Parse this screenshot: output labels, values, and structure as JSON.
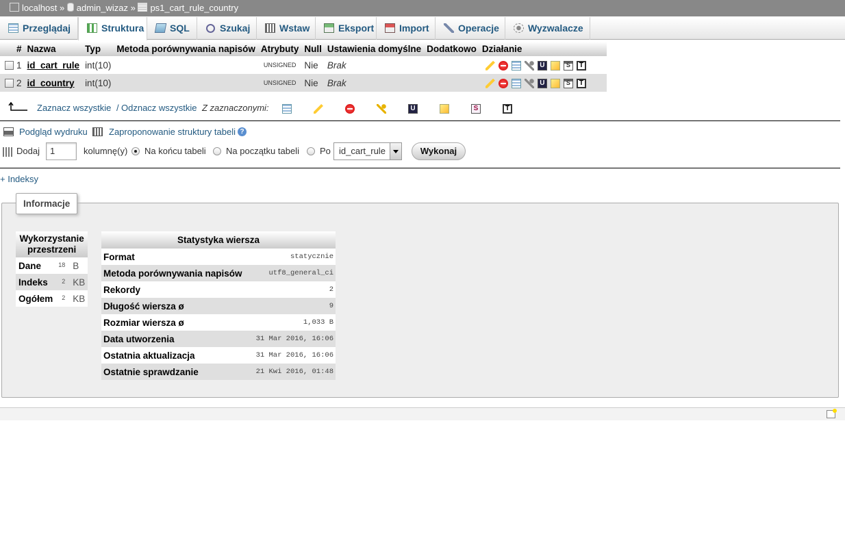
{
  "breadcrumb": {
    "server": "localhost",
    "database": "admin_wizaz",
    "table": "ps1_cart_rule_country",
    "separator": "»"
  },
  "tabs": [
    {
      "label": "Przeglądaj",
      "icon": "browse-icon"
    },
    {
      "label": "Struktura",
      "icon": "structure-icon",
      "active": true
    },
    {
      "label": "SQL",
      "icon": "sql-icon"
    },
    {
      "label": "Szukaj",
      "icon": "search-icon"
    },
    {
      "label": "Wstaw",
      "icon": "insert-icon"
    },
    {
      "label": "Eksport",
      "icon": "export-icon"
    },
    {
      "label": "Import",
      "icon": "import-icon"
    },
    {
      "label": "Operacje",
      "icon": "wrench-icon"
    },
    {
      "label": "Wyzwalacze",
      "icon": "triggers-icon"
    }
  ],
  "structure": {
    "headers": [
      "#",
      "Nazwa",
      "Typ",
      "Metoda porównywania napisów",
      "Atrybuty",
      "Null",
      "Ustawienia domyślne",
      "Dodatkowo",
      "Działanie"
    ],
    "rows": [
      {
        "num": "1",
        "name": "id_cart_rule",
        "type": "int(10)",
        "collation": "",
        "attributes": "UNSIGNED",
        "null": "Nie",
        "default": "Brak",
        "extra": ""
      },
      {
        "num": "2",
        "name": "id_country",
        "type": "int(10)",
        "collation": "",
        "attributes": "UNSIGNED",
        "null": "Nie",
        "default": "Brak",
        "extra": ""
      }
    ]
  },
  "bulk": {
    "check_all": "Zaznacz wszystkie",
    "separator": "/",
    "uncheck_all": "Odznacz wszystkie",
    "with_selected": "Z zaznaczonymi:"
  },
  "links": {
    "print_view": "Podgląd wydruku",
    "propose_structure": "Zaproponowanie struktury tabeli"
  },
  "add_column": {
    "label": "Dodaj",
    "count": "1",
    "unit": "kolumnę(y)",
    "at_end": "Na końcu tabeli",
    "at_beginning": "Na początku tabeli",
    "after": "Po",
    "after_field": "id_cart_rule",
    "go": "Wykonaj"
  },
  "indexes_link": "+ Indeksy",
  "info": {
    "legend": "Informacje",
    "space": {
      "header": "Wykorzystanie przestrzeni",
      "rows": [
        {
          "label": "Dane",
          "value": "18",
          "unit": "B"
        },
        {
          "label": "Indeks",
          "value": "2",
          "unit": "KB"
        },
        {
          "label": "Ogółem",
          "value": "2",
          "unit": "KB"
        }
      ]
    },
    "stats": {
      "header": "Statystyka wiersza",
      "rows": [
        {
          "label": "Format",
          "value": "statycznie"
        },
        {
          "label": "Metoda porównywania napisów",
          "value": "utf8_general_ci"
        },
        {
          "label": "Rekordy",
          "value": "2"
        },
        {
          "label": "Długość wiersza ø",
          "value": "9"
        },
        {
          "label": "Rozmiar wiersza ø",
          "value": "1,033 B"
        },
        {
          "label": "Data utworzenia",
          "value": "31 Mar 2016, 16:06"
        },
        {
          "label": "Ostatnia aktualizacja",
          "value": "31 Mar 2016, 16:06"
        },
        {
          "label": "Ostatnie sprawdzanie",
          "value": "21 Kwi 2016, 01:48"
        }
      ]
    }
  }
}
